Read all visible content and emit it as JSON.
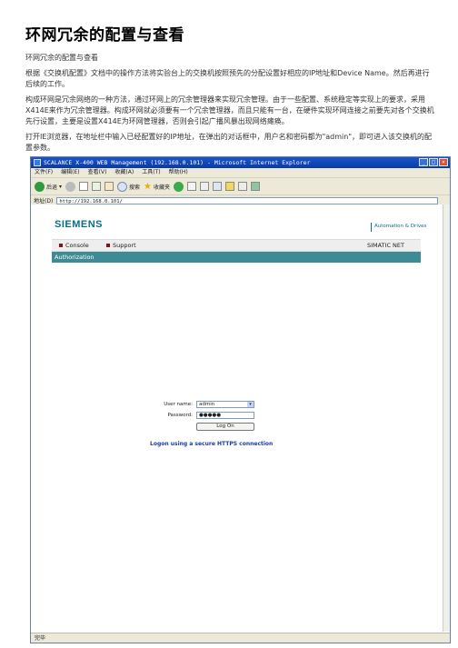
{
  "doc": {
    "title": "环网冗余的配置与查看",
    "subtitle": "环网冗余的配置与查看",
    "para1": "根据《交换机配置》文档中的操作方法将实验台上的交换机按照预先的分配设置好相应的IP地址和Device Name。然后再进行后续的工作。",
    "para2": "构成环网是冗余网络的一种方法，通过环网上的冗余管理器来实现冗余管理。由于一些配置、系统稳定等实现上的要求，采用X414E来作为冗余管理器。构成环网就必须要有一个冗余管理器，而且只能有一台，在硬件实现环网连接之前要先对各个交换机先行设置，主要是设置X414E为环网管理器，否则会引起广播风暴出现网络瘫痪。",
    "para3": "打开IE浏览器，在地址栏中输入已经配置好的IP地址，在弹出的对话框中，用户名和密码都为\"admin\"，即可进入该交换机的配置参数。"
  },
  "browser": {
    "window_title": "SCALANCE X-400 WEB Management (192.168.0.101) - Microsoft Internet Explorer",
    "menu": [
      "文件(F)",
      "编辑(E)",
      "查看(V)",
      "收藏(A)",
      "工具(T)",
      "帮助(H)"
    ],
    "toolbar": {
      "back": "后退",
      "search": "搜索",
      "favorites": "收藏夹"
    },
    "address_label": "地址(D)",
    "address": "http://192.168.0.101/",
    "status": "完毕"
  },
  "page": {
    "brand": "SIEMENS",
    "tagline": "Automation & Drives",
    "nav_console": "Console",
    "nav_support": "Support",
    "nav_right": "SIMATIC NET",
    "section": "Authorization",
    "username_label": "User name:",
    "username_value": "admin",
    "password_label": "Password:",
    "password_value": "●●●●●",
    "logon_button": "Log On",
    "https_link": "Logon using a secure HTTPS connection"
  },
  "colors": {
    "brand": "#0c6e84",
    "authbar": "#3d8c95",
    "bullet": "#8b0d20",
    "link": "#1a3aa8"
  }
}
